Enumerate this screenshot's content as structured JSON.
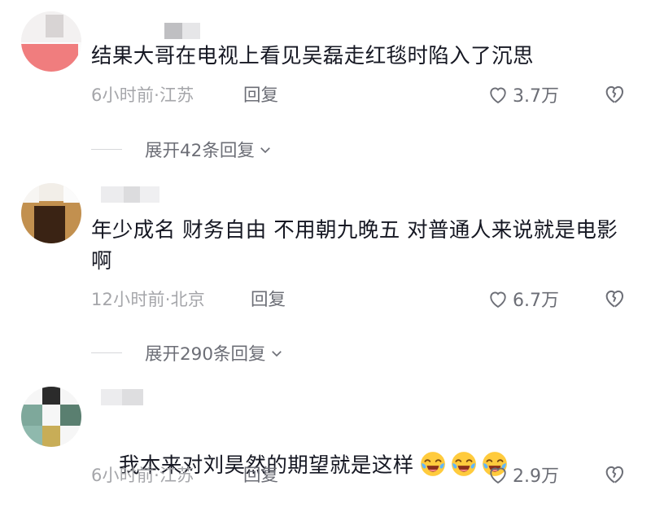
{
  "comments": [
    {
      "text": "结果大哥在电视上看见吴磊走红毯时陷入了沉思",
      "meta": "6小时前·江苏",
      "reply_label": "回复",
      "likes": "3.7万",
      "expand_label": "展开42条回复"
    },
    {
      "text": "年少成名 财务自由 不用朝九晚五 对普通人来说就是电影啊",
      "meta": "12小时前·北京",
      "reply_label": "回复",
      "likes": "6.7万",
      "expand_label": "展开290条回复"
    },
    {
      "text": "我本来对刘昊然的期望就是这样",
      "emoji": [
        "crying-laughing-emoji",
        "crying-laughing-emoji",
        "crying-laughing-emoji"
      ],
      "meta": "6小时前·江苏",
      "reply_label": "回复",
      "likes": "2.9万"
    }
  ],
  "icons": {
    "like": "heart-outline-icon",
    "dislike": "broken-heart-icon",
    "expand": "chevron-down-icon"
  },
  "colors": {
    "text": "#161823",
    "meta": "#a5a6aa",
    "action": "#6c6e76",
    "divider": "#d6d7da"
  }
}
